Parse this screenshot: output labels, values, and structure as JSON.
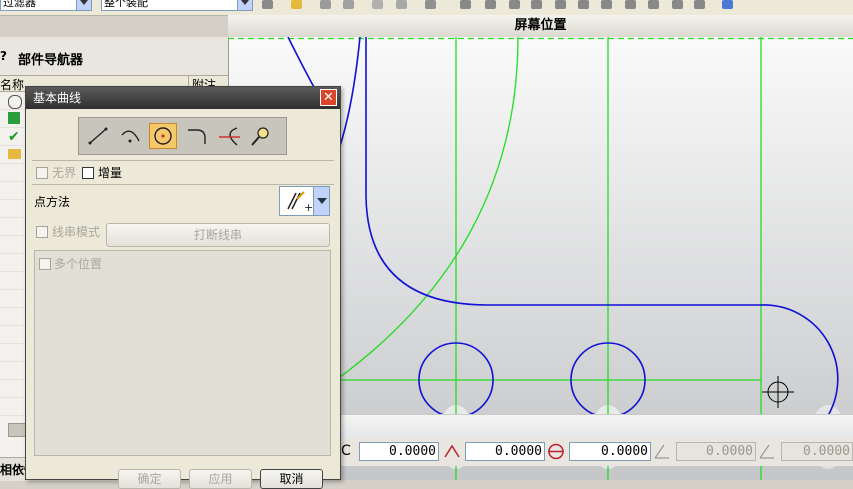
{
  "toolbar": {
    "filter_combo_value": "过滤器",
    "selection_combo_value": "整个装配"
  },
  "graphics_window": {
    "title": "屏幕位置"
  },
  "navigator": {
    "title": "部件导航器",
    "column_name": "名称",
    "column_right": "附注",
    "bottom_label": "相依性"
  },
  "dialog": {
    "title": "基本曲线",
    "close_glyph": "✕",
    "tools": [
      {
        "icon": "line-icon"
      },
      {
        "icon": "arc-icon"
      },
      {
        "icon": "circle-icon",
        "selected": true
      },
      {
        "icon": "fillet-icon"
      },
      {
        "icon": "trim-icon"
      },
      {
        "icon": "edit-curve-params-icon"
      }
    ],
    "unbounded_label": "无界",
    "incremental_label": "增量",
    "point_method_label": "点方法",
    "string_mode_label": "线串模式",
    "break_string_button": "打断线串",
    "multi_position_label": "多个位置",
    "ok_button": "确定",
    "apply_button": "应用",
    "cancel_button": "取消"
  },
  "coord_bar": {
    "xc_label": "C",
    "fields": [
      "0.0000",
      "0.0000",
      "0.0000",
      "0.0000",
      "0.0000"
    ]
  },
  "colors": {
    "curve_blue": "#1010d8",
    "datum_green": "#22dd22",
    "dialog_title_bg": "#3a3a3a",
    "close_red": "#d9462a"
  }
}
